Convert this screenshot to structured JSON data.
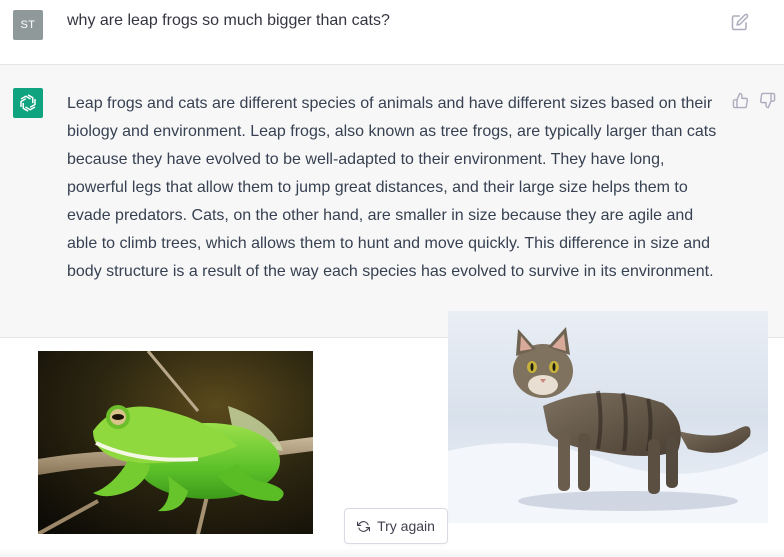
{
  "user_message": {
    "avatar_initials": "ST",
    "text": "why are leap frogs so much bigger than cats?"
  },
  "assistant_message": {
    "text": "Leap frogs and cats are different species of animals and have different sizes based on their biology and environment. Leap frogs, also known as tree frogs, are typically larger than cats because they have evolved to be well-adapted to their environment. They have long, powerful legs that allow them to jump great distances, and their large size helps them to evade predators. Cats, on the other hand, are smaller in size because they are agile and able to climb trees, which allows them to hunt and move quickly. This difference in size and body structure is a result of the way each species has evolved to survive in its environment."
  },
  "actions": {
    "try_again_label": "Try again"
  },
  "colors": {
    "accent": "#10a37f",
    "user_avatar": "#8f9999",
    "assistant_bg": "#f7f7f8"
  },
  "icons": [
    "edit-icon",
    "openai-logo-icon",
    "thumbs-up-icon",
    "thumbs-down-icon",
    "refresh-icon"
  ]
}
